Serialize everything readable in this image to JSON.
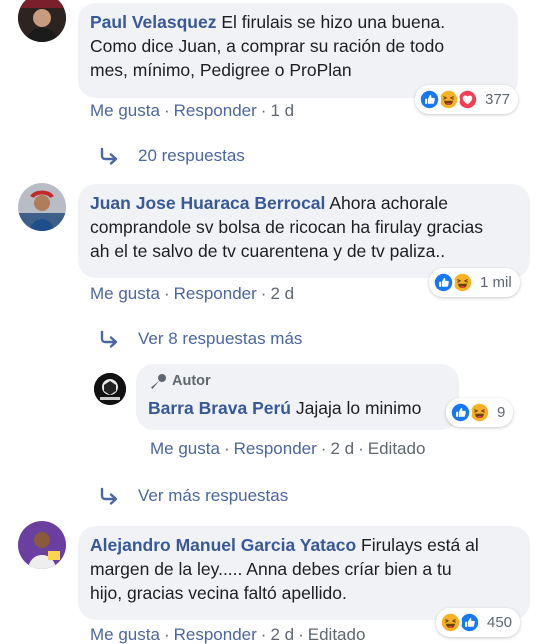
{
  "comments": [
    {
      "author": "Paul Velasquez",
      "text": "El firulais se hizo una buena. Como dice Juan, a comprar su ración de todo mes, mínimo, Pedigree o ProPlan",
      "line1": "El firulais se hizo una buena.",
      "line2": "Como dice Juan, a comprar su ración de todo",
      "line3": "mes, mínimo, Pedigree o ProPlan",
      "reactions": [
        "like-icon",
        "haha-icon",
        "love-icon"
      ],
      "reaction_count": "377",
      "like": "Me gusta",
      "reply": "Responder",
      "time": "1 d",
      "replies_label": "20 respuestas"
    },
    {
      "author": "Juan Jose Huaraca Berrocal",
      "line1": "Ahora achorale",
      "line2": "comprandole sv bolsa de ricocan ha firulay gracias",
      "line3": "ah el te salvo de tv cuarentena y de tv paliza..",
      "reactions": [
        "like-icon",
        "haha-icon"
      ],
      "reaction_count": "1 mil",
      "like": "Me gusta",
      "reply": "Responder",
      "time": "2 d",
      "replies_label": "Ver 8 respuestas más"
    },
    {
      "author_badge": "Autor",
      "author": "Barra Brava Perú",
      "line1": "Jajaja lo minimo",
      "reactions": [
        "like-icon",
        "haha-icon"
      ],
      "reaction_count": "9",
      "like": "Me gusta",
      "reply": "Responder",
      "time": "2 d",
      "edited": "Editado",
      "more_replies": "Ver más respuestas"
    },
    {
      "author": "Alejandro Manuel Garcia Yataco",
      "line1": "Firulays está al",
      "line2": "margen de la ley..... Anna debes críar bien a tu",
      "line3": "hijo, gracias vecina faltó apellido.",
      "reactions": [
        "haha-icon",
        "like-icon"
      ],
      "reaction_count": "450",
      "like": "Me gusta",
      "reply": "Responder",
      "time": "2 d",
      "edited": "Editado"
    }
  ],
  "colors": {
    "name": "#385898",
    "link": "#4b66a0",
    "bubble": "#f0f2f5",
    "like": "#1877f2",
    "haha": "#f7b125",
    "love": "#f33e58"
  },
  "separator": "·"
}
